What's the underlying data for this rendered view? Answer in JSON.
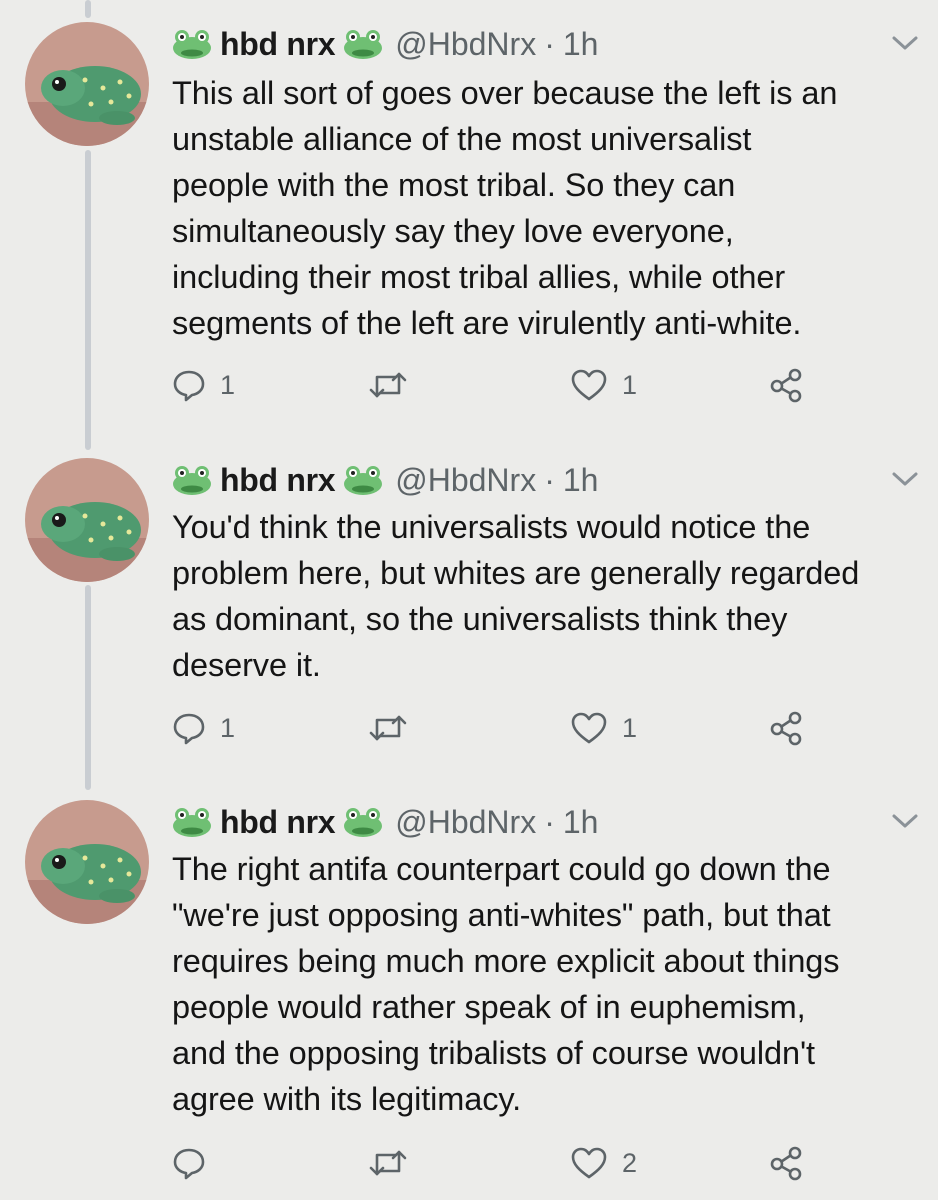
{
  "tweets": [
    {
      "display_name": "hbd nrx",
      "handle": "@HbdNrx",
      "separator": "·",
      "time": "1h",
      "text": "This all sort of goes over because the left is an\nunstable alliance of the most universalist\npeople with the most tribal. So they can\nsimultaneously say they love everyone,\nincluding their most tribal allies, while other\nsegments of the left are virulently anti-white.",
      "reply_count": "1",
      "retweet_count": "",
      "like_count": "1"
    },
    {
      "display_name": "hbd nrx",
      "handle": "@HbdNrx",
      "separator": "·",
      "time": "1h",
      "text": "You'd think the universalists would notice the\nproblem here, but whites are generally regarded\nas dominant, so the universalists think they\ndeserve it.",
      "reply_count": "1",
      "retweet_count": "",
      "like_count": "1"
    },
    {
      "display_name": "hbd nrx",
      "handle": "@HbdNrx",
      "separator": "·",
      "time": "1h",
      "text": "The right antifa counterpart could go down the\n\"we're just opposing anti-whites\" path, but that\nrequires being much more explicit about things\npeople would rather speak of in euphemism,\nand the opposing tribalists of course wouldn't\nagree with its legitimacy.",
      "reply_count": "",
      "retweet_count": "",
      "like_count": "2"
    }
  ],
  "icons": {
    "name_emoji": "frog-face-icon",
    "menu": "chevron-down-icon",
    "reply": "reply-bubble-icon",
    "retweet": "retweet-icon",
    "like": "heart-icon",
    "share": "share-icon"
  },
  "colors": {
    "background": "#ececea",
    "muted_text": "#5d6468",
    "thread_line": "#c9cdd2",
    "frog_green": "#6fbf73"
  }
}
